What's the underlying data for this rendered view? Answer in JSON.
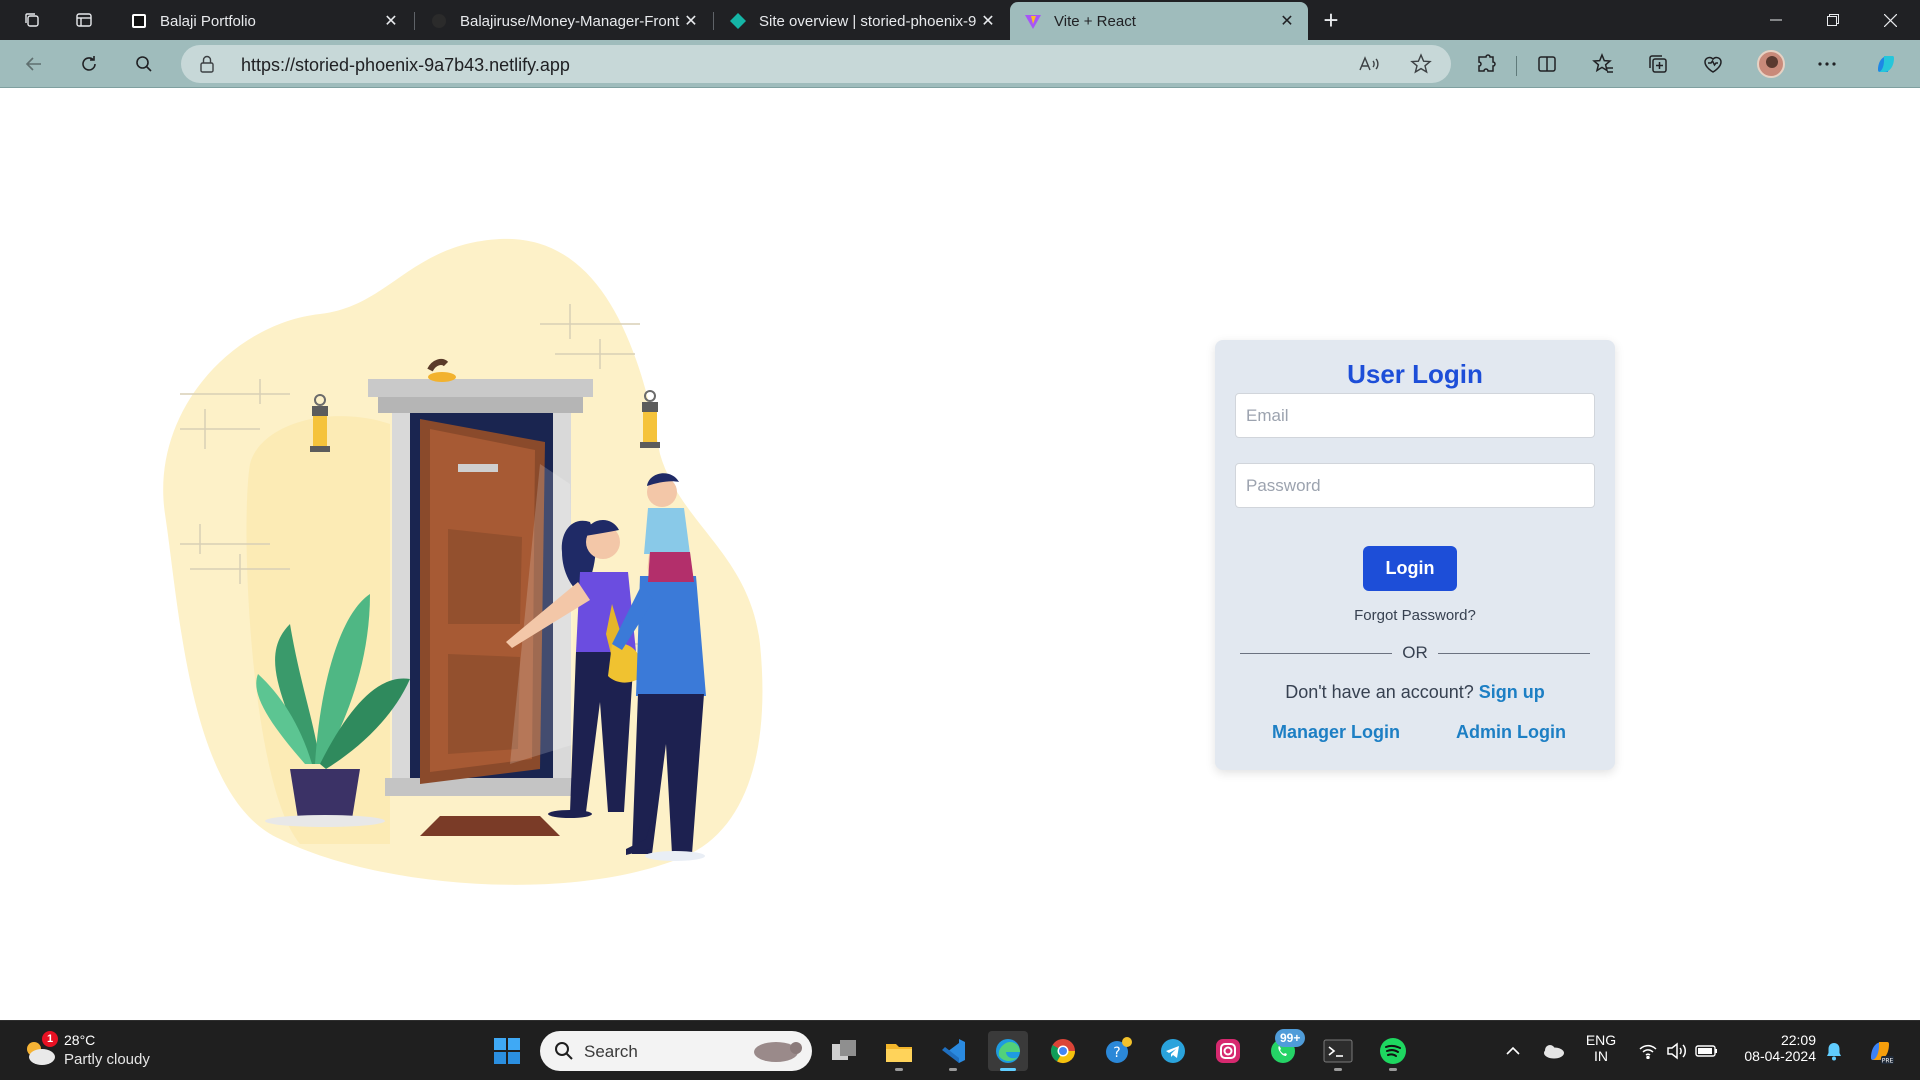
{
  "browser": {
    "tabs": [
      {
        "title": "Balaji Portfolio",
        "icon": "notion-style-page-icon"
      },
      {
        "title": "Balajiruse/Money-Manager-Front",
        "icon": "github-icon"
      },
      {
        "title": "Site overview | storied-phoenix-9",
        "icon": "netlify-icon"
      },
      {
        "title": "Vite + React",
        "icon": "vite-icon",
        "active": true
      }
    ],
    "url": "https://storied-phoenix-9a7b43.netlify.app"
  },
  "login": {
    "title": "User Login",
    "email_placeholder": "Email",
    "password_placeholder": "Password",
    "login_button": "Login",
    "forgot": "Forgot Password?",
    "or": "OR",
    "no_account": "Don't have an account?",
    "signup": "Sign up",
    "manager_login": "Manager Login",
    "admin_login": "Admin Login"
  },
  "taskbar": {
    "weather": {
      "temp": "28°C",
      "condition": "Partly cloudy",
      "badge": "1"
    },
    "search_label": "Search",
    "whatsapp_badge": "99+",
    "lang_top": "ENG",
    "lang_bottom": "IN",
    "time": "22:09",
    "date": "08-04-2024"
  },
  "colors": {
    "accent": "#1d4ed8",
    "link": "#1d7fc4",
    "card": "#e2e8f0",
    "chrome": "#9fbcbc"
  }
}
